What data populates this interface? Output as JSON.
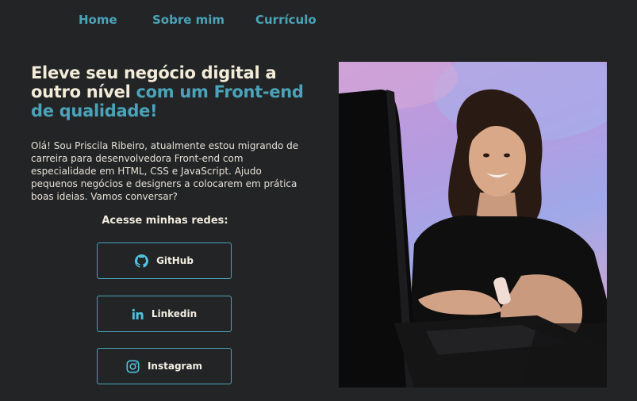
{
  "nav": {
    "items": [
      "Home",
      "Sobre mim",
      "Currículo"
    ]
  },
  "hero": {
    "headline_main": "Eleve seu negócio digital a outro nível",
    "headline_accent": "com um Front-end de qualidade!",
    "intro": "Olá! Sou Priscila Ribeiro, atualmente estou migrando de carreira para desenvolvedora Front-end com especialidade em HTML, CSS e JavaScript. Ajudo pequenos negócios e designers a colocarem em prática boas ideias. Vamos conversar?"
  },
  "social": {
    "title": "Acesse minhas redes:",
    "buttons": [
      {
        "label": "GitHub",
        "icon": "github-icon"
      },
      {
        "label": "Linkedin",
        "icon": "linkedin-icon"
      },
      {
        "label": "Instagram",
        "icon": "instagram-icon"
      }
    ]
  },
  "colors": {
    "background": "#232426",
    "accent": "#4aa3b8",
    "headline": "#f2ecd8"
  }
}
